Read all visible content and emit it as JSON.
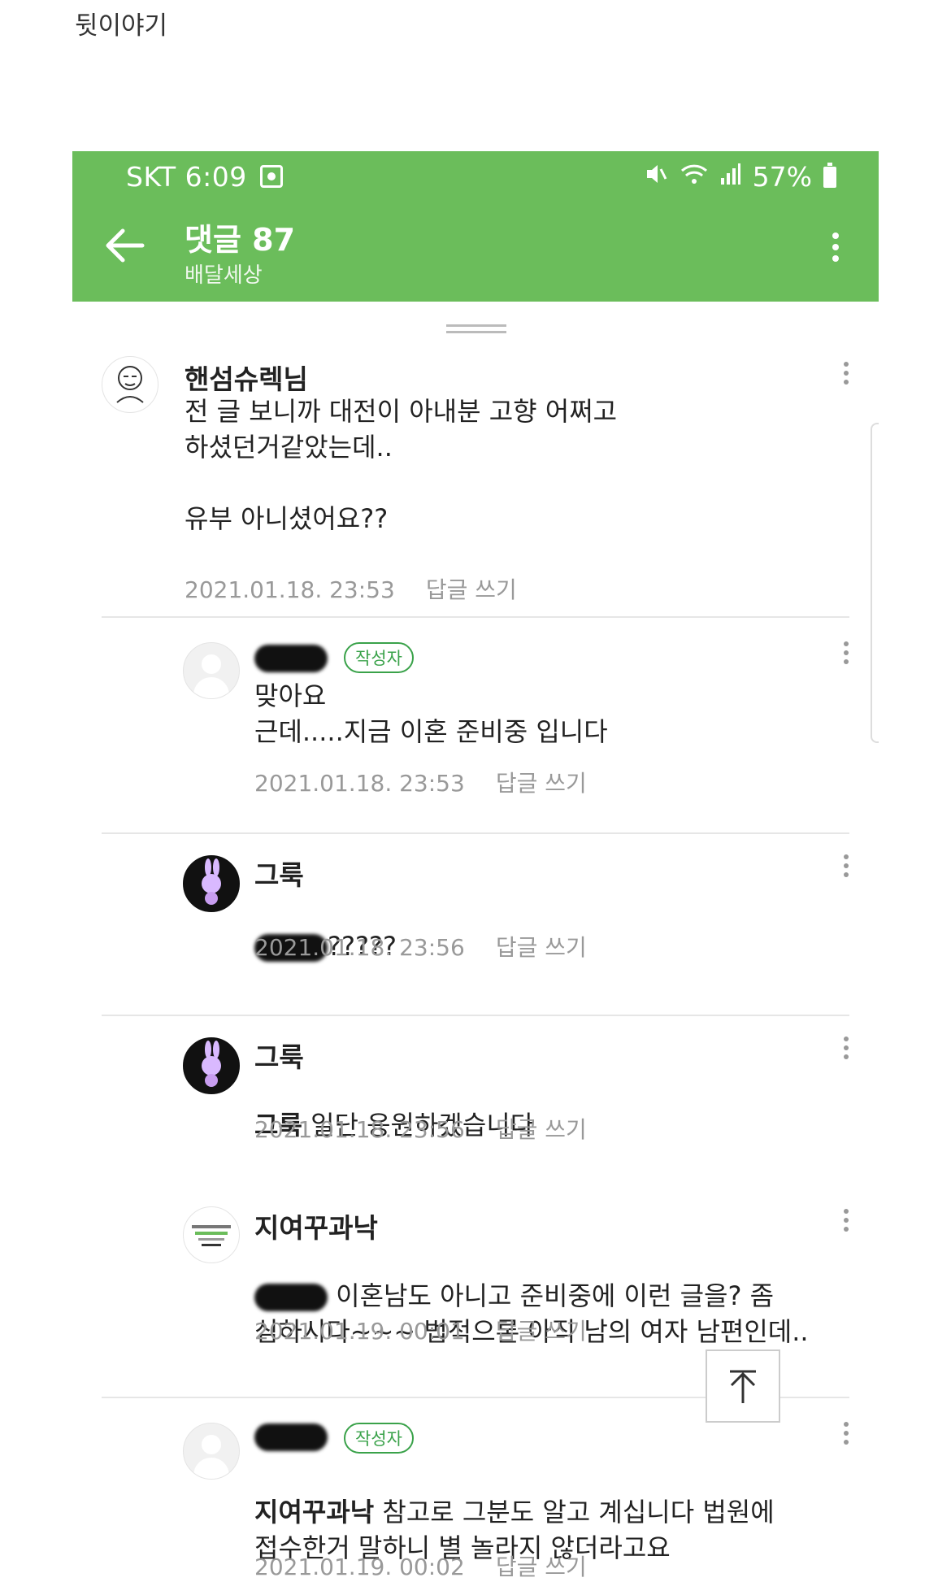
{
  "post": {
    "label": "뒷이야기"
  },
  "status": {
    "carrier_time": "SKT 6:09",
    "battery": "57%"
  },
  "header": {
    "title": "댓글 87",
    "subtitle": "배달세상"
  },
  "comments": [
    {
      "nick": "핸섬슈렉님",
      "badge": "",
      "mention": "",
      "text": "전 글 보니까 대전이 아내분 고향 어쩌고\n하셨던거같았는데..\n\n유부 아니셨어요??",
      "date": "2021.01.18. 23:53",
      "reply": "답글 쓰기",
      "avatar": "sketch"
    },
    {
      "nick": "",
      "badge": "작성자",
      "mention": "",
      "text": "맞아요\n근데.....지금 이혼 준비중 입니다",
      "date": "2021.01.18. 23:53",
      "reply": "답글 쓰기",
      "avatar": "default"
    },
    {
      "nick": "그룩",
      "badge": "",
      "mention": "",
      "text": "?????",
      "date": "2021.01.18. 23:56",
      "reply": "답글 쓰기",
      "avatar": "dark"
    },
    {
      "nick": "그룩",
      "badge": "",
      "mention": "그룩",
      "text": " 일단 응원하겠습니다",
      "date": "2021.01.18. 23:56",
      "reply": "답글 쓰기",
      "avatar": "dark"
    },
    {
      "nick": "지여꾸과낙",
      "badge": "",
      "mention": "",
      "text": " 이혼남도 아니고 준비중에 이런 글을? 좀\n심하시다~~~ 법적으론 아직 남의 여자 남편인데..",
      "date": "2021.01.19. 00:01",
      "reply": "답글 쓰기",
      "avatar": "logo"
    },
    {
      "nick": "",
      "badge": "작성자",
      "mention": "지여꾸과낙",
      "text": " 참고로 그분도 알고 계십니다 법원에\n접수한거 말하니 별 놀라지 않더라고요",
      "date": "2021.01.19. 00:02",
      "reply": "답글 쓰기",
      "avatar": "default"
    }
  ]
}
